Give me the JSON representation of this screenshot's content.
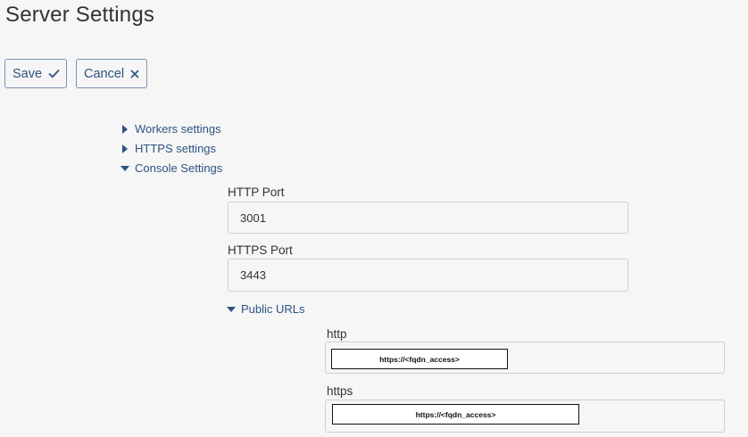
{
  "page": {
    "title": "Server Settings"
  },
  "toolbar": {
    "save_label": "Save",
    "cancel_label": "Cancel"
  },
  "sections": [
    {
      "label": "Workers settings",
      "expanded": false
    },
    {
      "label": "HTTPS settings",
      "expanded": false
    },
    {
      "label": "Console Settings",
      "expanded": true
    }
  ],
  "console": {
    "http_port_label": "HTTP Port",
    "http_port_value": "3001",
    "https_port_label": "HTTPS Port",
    "https_port_value": "3443",
    "public_urls_label": "Public URLs",
    "public_urls_expanded": true,
    "public_urls": {
      "http_label": "http",
      "http_value": "https://<fqdn_access>",
      "https_label": "https",
      "https_value": "https://<fqdn_access>"
    }
  },
  "colors": {
    "accent": "#2d5280",
    "border": "#cfcfcf",
    "background": "#f6f6f6"
  }
}
